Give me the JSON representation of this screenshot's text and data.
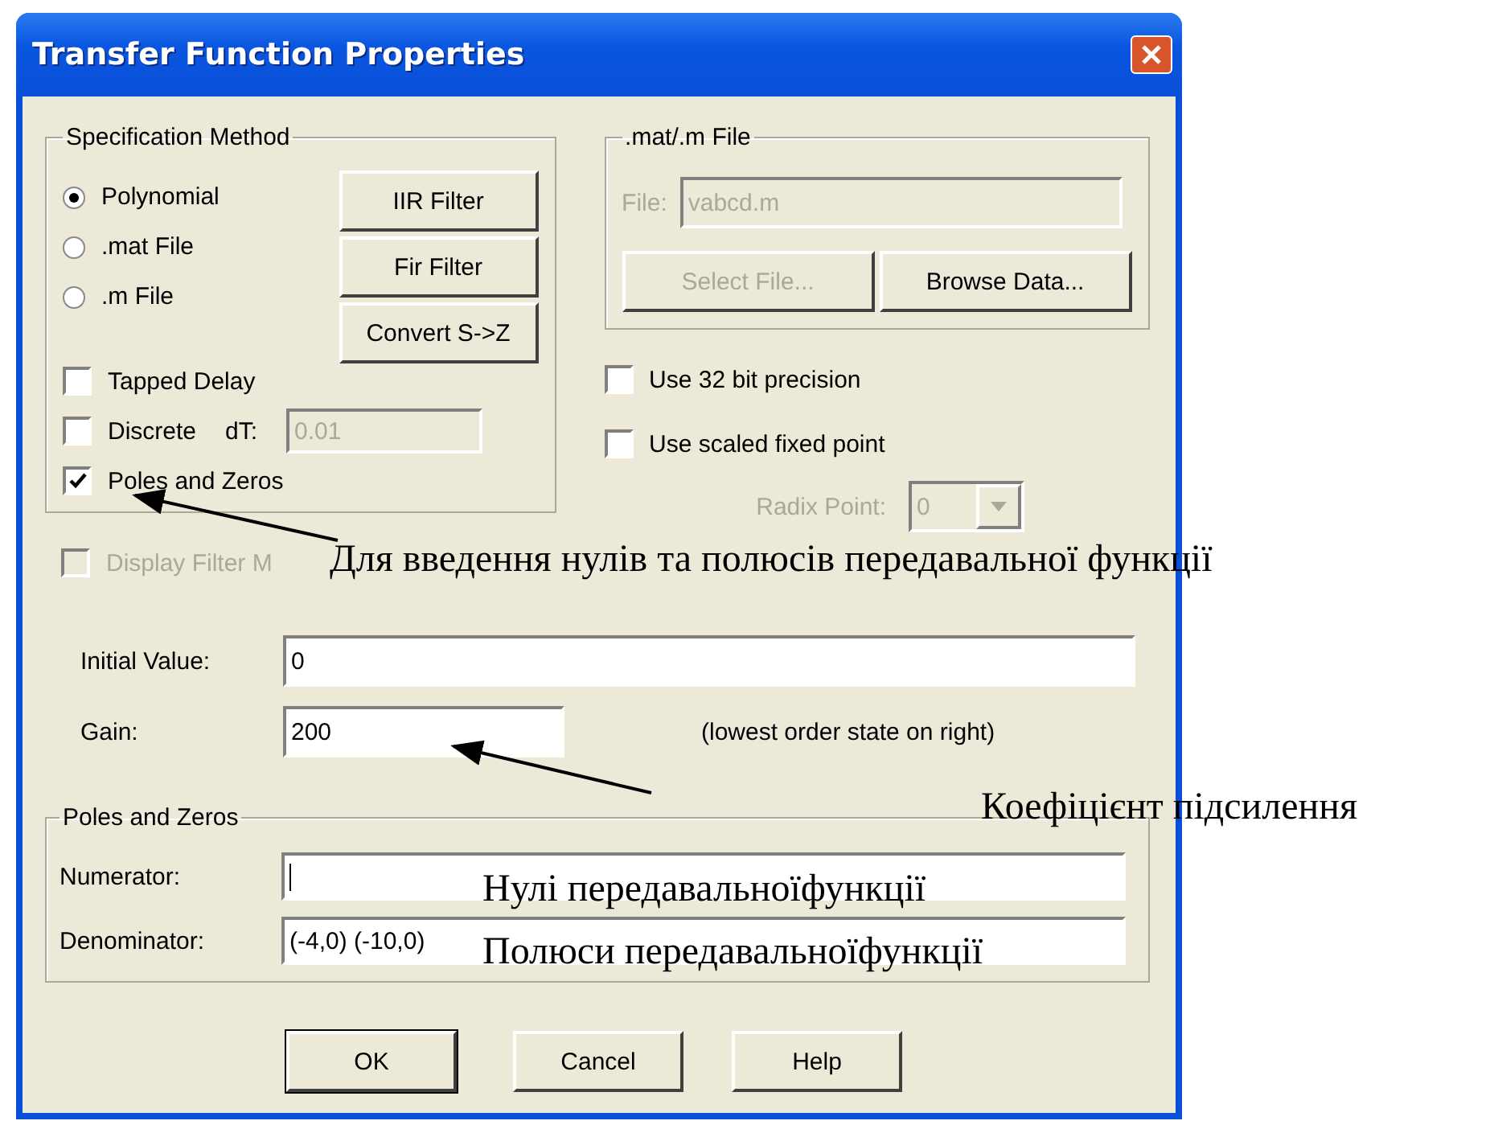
{
  "window": {
    "title": "Transfer Function Properties"
  },
  "specification_method": {
    "title": "Specification Method",
    "options": [
      {
        "label": "Polynomial",
        "selected": true
      },
      {
        "label": ".mat File",
        "selected": false
      },
      {
        "label": ".m File",
        "selected": false
      }
    ],
    "buttons": [
      {
        "label": "IIR Filter"
      },
      {
        "label": "Fir Filter"
      },
      {
        "label": "Convert S->Z"
      }
    ],
    "checkboxes": [
      {
        "label": "Tapped Delay",
        "checked": false
      },
      {
        "label": "Discrete",
        "checked": false
      },
      {
        "label": "Poles and Zeros",
        "checked": true
      }
    ],
    "dt": {
      "label": "dT:",
      "value": "0.01",
      "disabled": true
    }
  },
  "file_group": {
    "title": ".mat/.m File",
    "file_label": "File:",
    "file": {
      "value": "vabcd.m",
      "disabled": true
    },
    "buttons": [
      {
        "label": "Select File...",
        "disabled": true
      },
      {
        "label": "Browse Data...",
        "disabled": false
      }
    ]
  },
  "precision": [
    {
      "label": "Use 32 bit precision",
      "checked": false
    },
    {
      "label": "Use scaled fixed point",
      "checked": false
    }
  ],
  "radix": {
    "label": "Radix Point:",
    "value": "0",
    "disabled": true
  },
  "display_filter": {
    "label": "Display Filter M",
    "checked": false,
    "disabled": true
  },
  "initial_value": {
    "label": "Initial Value:",
    "value": "0"
  },
  "gain": {
    "label": "Gain:",
    "value": "200",
    "hint": "(lowest order state on right)"
  },
  "poles_zeros": {
    "title": "Poles and Zeros",
    "numerator": {
      "label": "Numerator:"
    },
    "denominator": {
      "label": "Denominator:",
      "value": "(-4,0) (-10,0)"
    }
  },
  "buttons": [
    {
      "label": "OK",
      "default": true
    },
    {
      "label": "Cancel",
      "default": false
    },
    {
      "label": "Help",
      "default": false
    }
  ],
  "annotations": [
    {
      "text": "Для введення нулів та полюсів передавальної функції"
    },
    {
      "text": "Коефіцієнт підсилення"
    },
    {
      "text": "Нулі передавальноїфункції"
    },
    {
      "text": "Полюси передавальноїфункції"
    }
  ]
}
